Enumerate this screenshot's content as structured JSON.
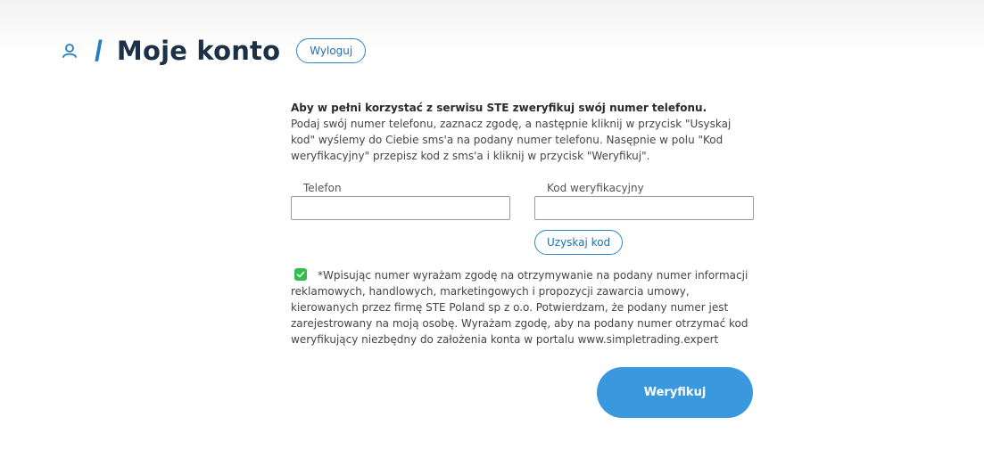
{
  "header": {
    "separator": "/",
    "title": "Moje konto",
    "logout_label": "Wyloguj",
    "user_icon": "user-icon"
  },
  "intro": {
    "heading": "Aby w pełni korzystać z serwisu STE zweryfikuj swój numer telefonu.",
    "body": "Podaj swój numer telefonu, zaznacz zgodę, a następnie kliknij w przycisk \"Usyskaj kod\" wyślemy do Ciebie sms'a na podany numer telefonu. Nasępnie w polu \"Kod weryfikacyjny\" przepisz kod z sms'a i kliknij w przycisk \"Weryfikuj\"."
  },
  "form": {
    "phone_label": "Telefon",
    "phone_value": "",
    "code_label": "Kod weryfikacyjny",
    "code_value": "",
    "get_code_label": "Uzyskaj kod"
  },
  "consent": {
    "checked": true,
    "text": "*Wpisując numer wyrażam zgodę na otrzymywanie na podany numer informacji reklamowych, handlowych, marketingowych i propozycji zawarcia umowy, kierowanych przez firmę STE Poland sp z o.o. Potwierdzam, że podany numer jest zarejestrowany na moją osobę. Wyrażam zgodę, aby na podany numer otrzymać kod weryfikujący niezbędny do założenia konta w portalu www.simpletrading.expert"
  },
  "actions": {
    "verify_label": "Weryfikuj"
  },
  "colors": {
    "accent": "#3a98df",
    "title": "#1c3145",
    "checkbox": "#2fbf4a"
  }
}
